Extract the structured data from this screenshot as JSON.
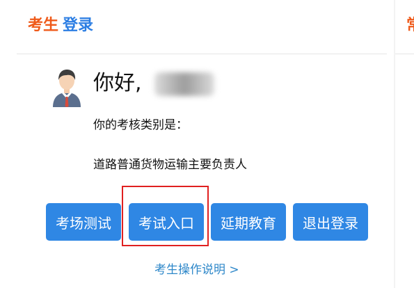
{
  "header": {
    "prefix": "考生",
    "title": "登录"
  },
  "side_peek": {
    "text": "常"
  },
  "user": {
    "greeting": "你好,",
    "category_label": "你的考核类别是：",
    "category_value": "道路普通货物运输主要负责人"
  },
  "buttons": {
    "exam_test": "考场测试",
    "exam_entry": "考试入口",
    "extended_education": "延期教育",
    "logout": "退出登录"
  },
  "help_link": "考生操作说明 >",
  "colors": {
    "orange": "#ef5a1a",
    "blue": "#2c7ee3",
    "button_blue": "#2f87e4",
    "highlight_red": "#e02020",
    "link_blue": "#2d87c9"
  }
}
